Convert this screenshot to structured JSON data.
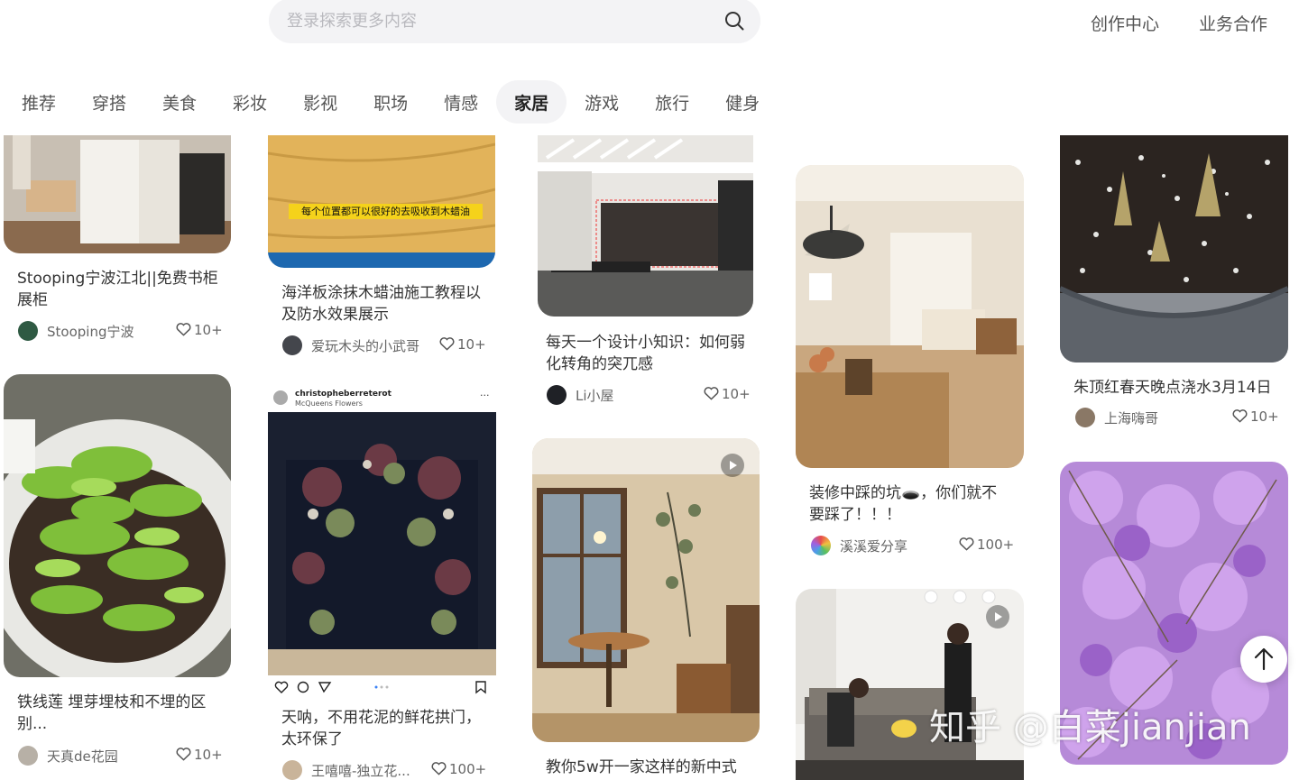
{
  "header": {
    "search_placeholder": "登录探索更多内容",
    "links": [
      "创作中心",
      "业务合作"
    ]
  },
  "tabs": [
    "推荐",
    "穿搭",
    "美食",
    "彩妆",
    "影视",
    "职场",
    "情感",
    "家居",
    "游戏",
    "旅行",
    "健身"
  ],
  "active_tab": "家居",
  "cards": [
    {
      "title": "Stooping宁波江北||免费书柜展柜",
      "author": "Stooping宁波",
      "likes": "10+"
    },
    {
      "title": "铁线莲 埋芽埋枝和不埋的区别...",
      "author": "天真de花园",
      "likes": "10+"
    },
    {
      "title": "海洋板涂抹木蜡油施工教程以及防水效果展示",
      "author": "爱玩木头的小武哥",
      "likes": "10+",
      "image_caption": "每个位置都可以很好的去吸收到木蜡油"
    },
    {
      "title": "天呐，不用花泥的鲜花拱门，太环保了",
      "author": "王嘻嘻-独立花...",
      "likes": "100+",
      "ig_user": "christopheberreterot",
      "ig_sub": "McQueens Flowers"
    },
    {
      "title": "每天一个设计小知识：如何弱化转角的突兀感",
      "author": "Li小屋",
      "likes": "10+"
    },
    {
      "title": "教你5w开一家这样的新中式",
      "author": "",
      "likes": ""
    },
    {
      "title": "装修中踩的坑🕳️，你们就不要踩了！！！",
      "author": "溪溪爱分享",
      "likes": "100+"
    },
    {
      "title": "",
      "author": "",
      "likes": ""
    },
    {
      "title": "朱顶红春天晚点浇水3月14日",
      "author": "上海嗨哥",
      "likes": "10+"
    },
    {
      "title": "",
      "author": "",
      "likes": ""
    }
  ],
  "watermark": "知乎 @白菜jianjian",
  "icons": [
    "search-icon",
    "heart-icon",
    "arrow-up-icon",
    "play-icon"
  ],
  "colors": {
    "accent": "#f5d21b",
    "tab_active_bg": "#f3f3f5"
  }
}
